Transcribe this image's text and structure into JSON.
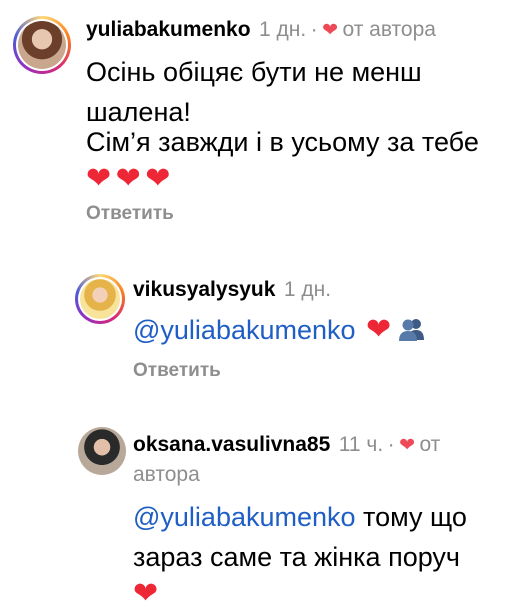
{
  "comments": [
    {
      "username": "yuliabakumenko",
      "age": "1 дн.",
      "sep": "·",
      "author_like": "от автора",
      "text_lines": [
        "Осінь обіцяє бути не менш",
        "шалена!"
      ],
      "text2": "Сім’я завжди і в усьому за тебе",
      "emojis": [
        "❤",
        "❤",
        "❤"
      ],
      "reply_label": "Ответить"
    },
    {
      "username": "vikusyalysyuk",
      "age": "1 дн.",
      "mention": "@yuliabakumenko",
      "emojis": [
        "❤",
        "👥"
      ],
      "reply_label": "Ответить"
    },
    {
      "username": "oksana.vasulivna85",
      "age": "11 ч.",
      "sep": "·",
      "author_like_part1": "от",
      "author_like_part2": "автора",
      "mention": "@yuliabakumenko",
      "text_part1": " тому що",
      "text_part2": "зараз саме та жінка поруч",
      "emojis": [
        "❤"
      ]
    }
  ],
  "colors": {
    "mention": "#1f5ec5",
    "heart": "#ed2736",
    "muted": "#8e8e8e"
  }
}
